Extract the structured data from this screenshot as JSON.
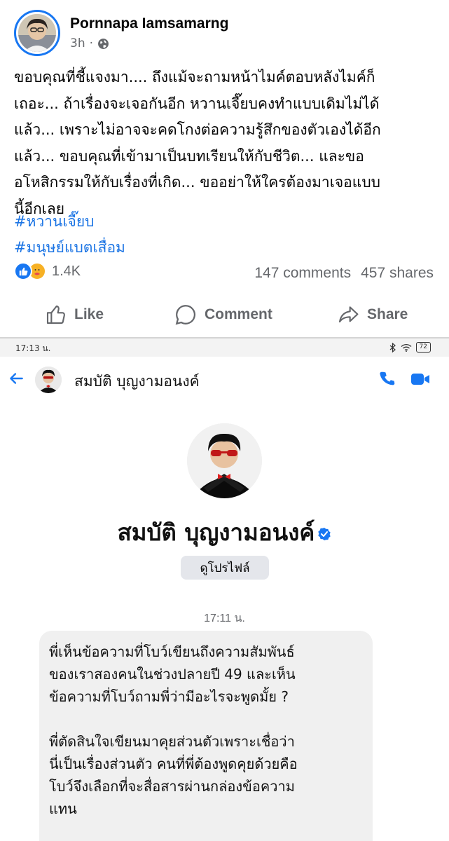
{
  "post": {
    "author": "Pornnapa Iamsamarng",
    "time": "3h",
    "lines": [
      "ขอบคุณที่ชี้แจงมา.... ถึงแม้จะถามหน้าไมค์ตอบหลังไมค์ก็",
      "เถอะ... ถ้าเรื่องจะเจอกันอีก หวานเจี๊ยบคงทำแบบเดิมไม่ได้",
      "แล้ว... เพราะไม่อาจจะคดโกงต่อความรู้สึกของตัวเองได้อีก",
      "แล้ว... ขอบคุณที่เข้ามาเป็นบทเรียนให้กับชีวิต... และขอ",
      "อโหสิกรรมให้กับเรื่องที่เกิด... ขออย่าให้ใครต้องมาเจอแบบ",
      "นี้อีกเลย"
    ],
    "hashtags": [
      "#หวานเจี๊ยบ",
      "#มนุษย์แบตเสื่อม"
    ],
    "reaction_count": "1.4K",
    "comments": "147 comments",
    "shares": "457 shares",
    "actions": {
      "like": "Like",
      "comment": "Comment",
      "share": "Share"
    },
    "colors": {
      "accent": "#1877f2",
      "hashtag": "#1b74e4",
      "muted": "#65676b"
    }
  },
  "statusbar": {
    "time": "17:13 น.",
    "battery": "72"
  },
  "messenger": {
    "contact_name": "สมบัติ บุญงามอนงค์",
    "profile_name": "สมบัติ บุญงามอนงค์",
    "view_profile": "ดูโปรไฟล์",
    "message_time": "17:11 น.",
    "message_paragraphs": [
      [
        "พี่เห็นข้อความที่โบว์เขียนถึงความสัมพันธ์",
        "ของเราสองคนในช่วงปลายปี 49 และเห็น",
        "ข้อความที่โบว์ถามพี่ว่ามีอะไรจะพูดมั้ย ?"
      ],
      [
        "พี่ตัดสินใจเขียนมาคุยส่วนตัวเพราะเชื่อว่า",
        "นี่เป็นเรื่องส่วนตัว คนที่พี่ต้องพูดคุยด้วยคือ",
        "โบว์จึงเลือกที่จะสื่อสารผ่านกล่องข้อความ",
        "แทน"
      ]
    ],
    "colors": {
      "accent": "#1877f2",
      "bubble": "#f0f0f0"
    }
  }
}
